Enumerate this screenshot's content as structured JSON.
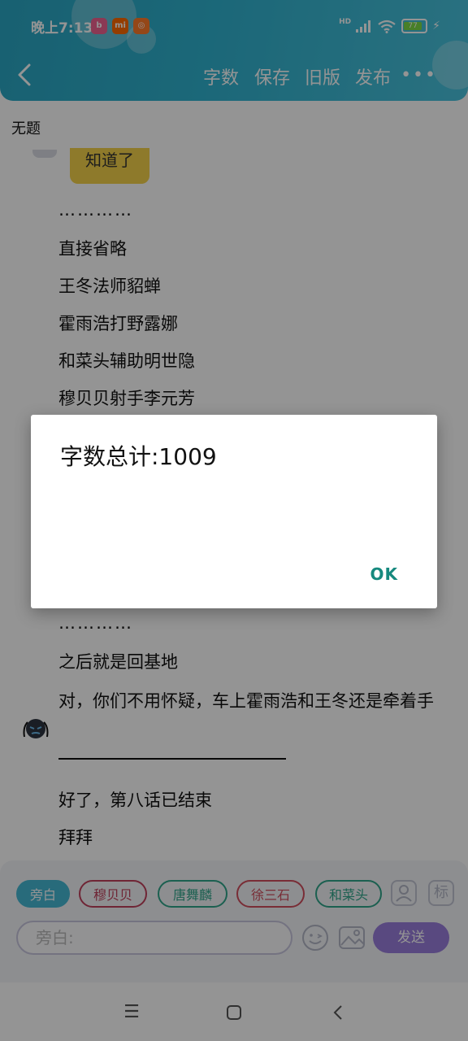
{
  "status_bar": {
    "time": "晚上7:13",
    "battery": "77",
    "network": "HD",
    "app_icons": [
      "bilibili-icon",
      "mi-icon",
      "app-icon"
    ]
  },
  "toolbar": {
    "back_icon": "chevron-left-icon",
    "word_count_label": "字数",
    "save_label": "保存",
    "old_version_label": "旧版",
    "publish_label": "发布",
    "more_icon": "more-horizontal-icon"
  },
  "document": {
    "title": "无题",
    "bubble_text": "知道了",
    "lines": [
      "…………",
      "直接省略",
      "王冬法师貂蝉",
      "霍雨浩打野露娜",
      "和菜头辅助明世隐",
      "穆贝贝射手李元芳"
    ],
    "lines_after": [
      "…………",
      "之后就是回基地"
    ],
    "wrap_line": "对，你们不用怀疑，车上霍雨浩和王冬还是牵着手",
    "ending_lines": [
      "好了，第八话已结束",
      "拜拜"
    ]
  },
  "dialog": {
    "message": "字数总计:1009",
    "ok_label": "OK"
  },
  "input_panel": {
    "chips": [
      "旁白",
      "穆贝贝",
      "唐舞麟",
      "徐三石",
      "和菜头"
    ],
    "chip_colors": [
      "#46b9d4",
      "#c0405c",
      "#2fa58a",
      "#d04e5e",
      "#2fa58a"
    ],
    "user_icon": "person-icon",
    "tag_icon_text": "标",
    "input_placeholder": "旁白:",
    "emoji_icon": "emoji-icon",
    "image_icon": "image-icon",
    "send_label": "发送"
  },
  "nav_bar": {
    "menu_icon": "menu-icon",
    "home_icon": "home-square-icon",
    "back_icon": "back-triangle-icon"
  },
  "colors": {
    "header": "#30b3d0",
    "accent_send": "#9a7edc",
    "dialog_ok": "#16897e",
    "bubble": "#f5d24a"
  }
}
